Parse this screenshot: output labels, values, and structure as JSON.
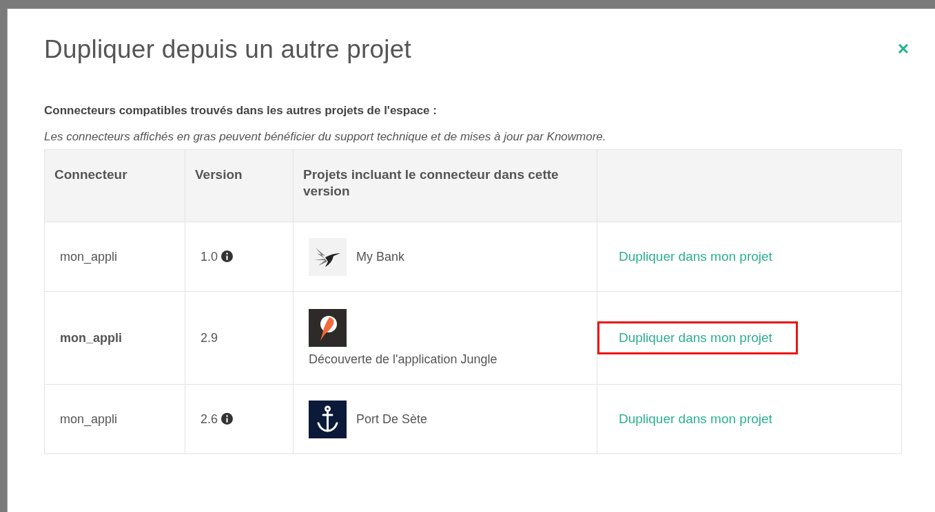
{
  "dialog": {
    "title": "Dupliquer depuis un autre projet",
    "close": "×",
    "heading": "Connecteurs compatibles trouvés dans les autres projets de l'espace :",
    "note": "Les connecteurs affichés en gras peuvent bénéficier du support technique et de mises à jour par Knowmore.",
    "table": {
      "columns": [
        "Connecteur",
        "Version",
        "Projets incluant le connecteur dans cette version"
      ],
      "rows": [
        {
          "connector": "mon_appli",
          "bold": false,
          "version": "1.0",
          "info": true,
          "project": "My Bank",
          "kind": "bird",
          "stacked": false,
          "action": "Dupliquer dans mon projet",
          "highlighted": false
        },
        {
          "connector": "mon_appli",
          "bold": true,
          "version": "2.9",
          "info": false,
          "project": "Découverte de l'application Jungle",
          "kind": "parrot",
          "stacked": true,
          "action": "Dupliquer dans mon projet",
          "highlighted": true
        },
        {
          "connector": "mon_appli",
          "bold": false,
          "version": "2.6",
          "info": true,
          "project": "Port De Sète",
          "kind": "anchor",
          "stacked": false,
          "action": "Dupliquer dans mon projet",
          "highlighted": false
        }
      ]
    }
  }
}
